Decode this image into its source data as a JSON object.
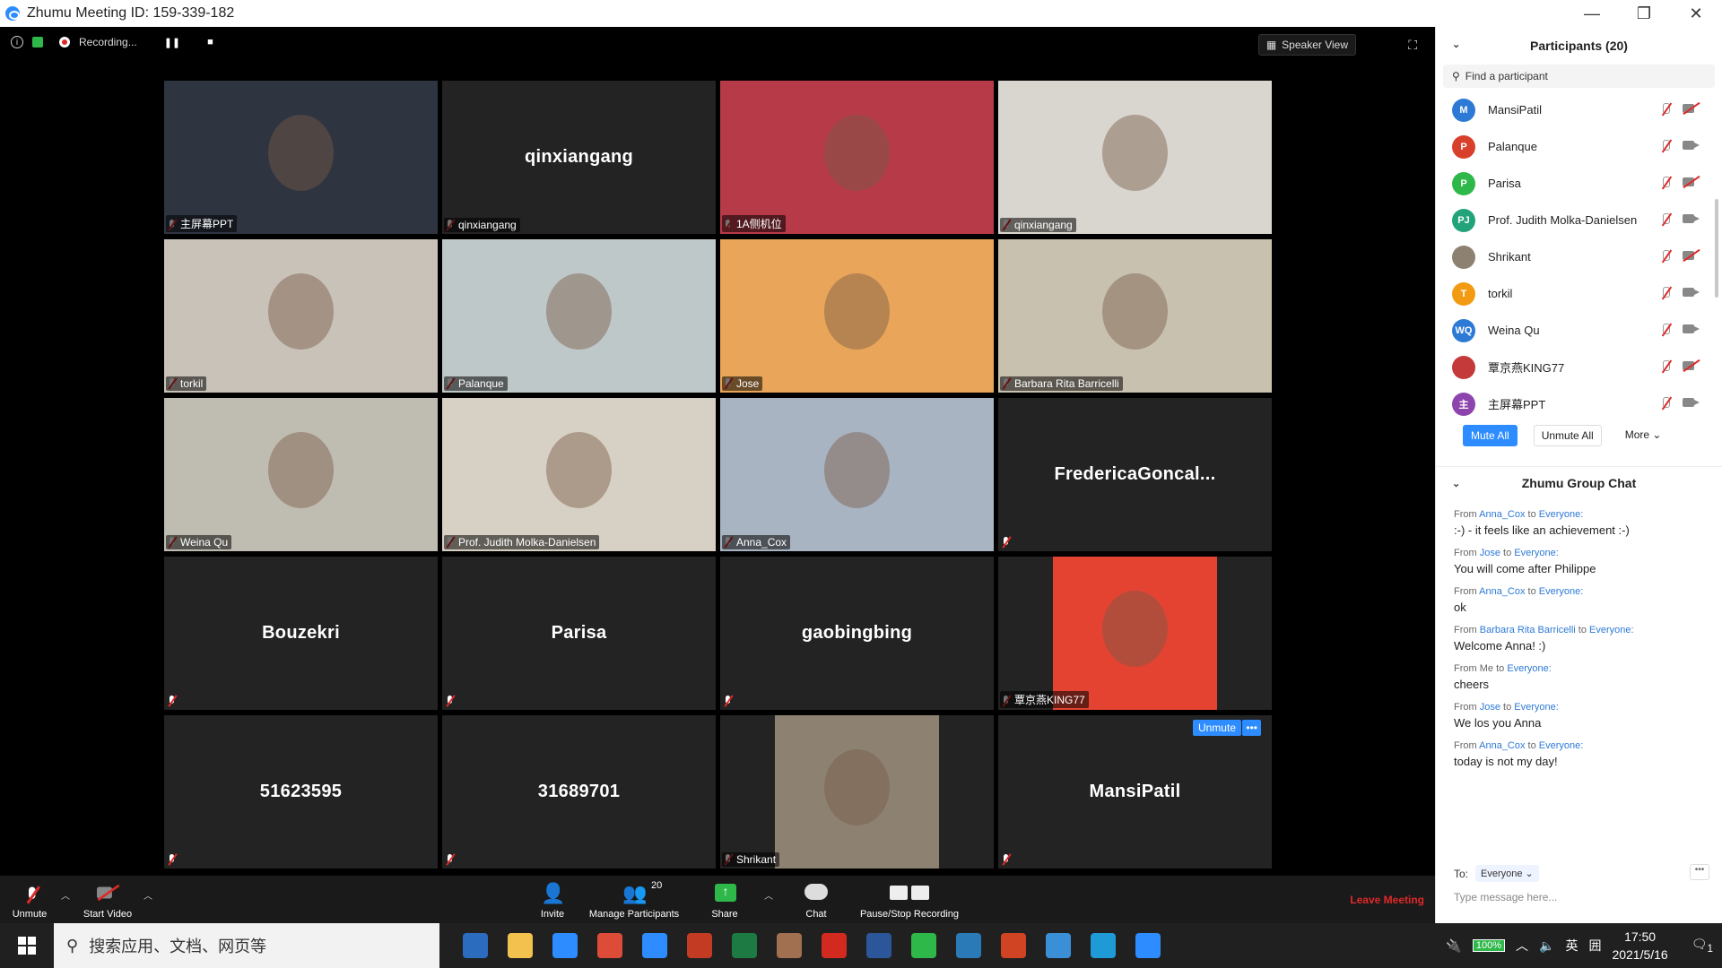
{
  "window": {
    "title": "Zhumu Meeting ID: 159-339-182",
    "min": "—",
    "restore": "❐",
    "close": "✕"
  },
  "topbar": {
    "recording": "Recording...",
    "pause": "❚❚",
    "stop": "■",
    "speaker_view": "Speaker View"
  },
  "tiles": [
    {
      "name": "主屏幕PPT",
      "type": "video",
      "bg": "#2e3440"
    },
    {
      "name": "qinxiangang",
      "type": "name",
      "big": "qinxiangang"
    },
    {
      "name": "1A侧机位",
      "type": "video",
      "bg": "#b73a48"
    },
    {
      "name": "qinxiangang",
      "type": "video",
      "bg": "#d9d6cf"
    },
    {
      "name": "torkil",
      "type": "video",
      "bg": "#c9c2b8"
    },
    {
      "name": "Palanque",
      "type": "video",
      "bg": "#bfc8c8",
      "active": true
    },
    {
      "name": "Jose",
      "type": "video",
      "bg": "#e9a65a"
    },
    {
      "name": "Barbara Rita Barricelli",
      "type": "video",
      "bg": "#c9c1b0"
    },
    {
      "name": "Weina Qu",
      "type": "video",
      "bg": "#bfbcb1"
    },
    {
      "name": "Prof. Judith Molka-Danielsen",
      "type": "video",
      "bg": "#d7d0c4"
    },
    {
      "name": "Anna_Cox",
      "type": "video",
      "bg": "#a9b4c3"
    },
    {
      "name": "",
      "type": "name",
      "big": "FredericaGoncal..."
    },
    {
      "name": "",
      "type": "name",
      "big": "Bouzekri"
    },
    {
      "name": "",
      "type": "name",
      "big": "Parisa"
    },
    {
      "name": "",
      "type": "name",
      "big": "gaobingbing"
    },
    {
      "name": "覃京燕KING77",
      "type": "photo",
      "bg": "#e44332"
    },
    {
      "name": "",
      "type": "name",
      "big": "51623595"
    },
    {
      "name": "",
      "type": "name",
      "big": "31689701"
    },
    {
      "name": "Shrikant",
      "type": "photo",
      "bg": "#8d8272"
    },
    {
      "name": "",
      "type": "name",
      "big": "MansiPatil",
      "overlay_unmute": "Unmute",
      "overlay_more": "•••"
    }
  ],
  "toolbar": {
    "unmute": "Unmute",
    "start_video": "Start Video",
    "invite": "Invite",
    "manage": "Manage Participants",
    "participant_count": "20",
    "share": "Share",
    "chat": "Chat",
    "record": "Pause/Stop Recording",
    "leave": "Leave Meeting"
  },
  "participants": {
    "title": "Participants (20)",
    "search_placeholder": "Find a participant",
    "list": [
      {
        "name": "MansiPatil",
        "initials": "M",
        "color": "#2d7ad6",
        "video_off": true
      },
      {
        "name": "Palanque",
        "initials": "P",
        "color": "#d9402b",
        "video_off": false
      },
      {
        "name": "Parisa",
        "initials": "P",
        "color": "#2fb84a",
        "video_off": true
      },
      {
        "name": "Prof. Judith Molka-Danielsen",
        "initials": "PJ",
        "color": "#23a37a",
        "video_off": false
      },
      {
        "name": "Shrikant",
        "initials": "",
        "color": "#8d8272",
        "video_off": true
      },
      {
        "name": "torkil",
        "initials": "T",
        "color": "#f29a12",
        "video_off": false
      },
      {
        "name": "Weina Qu",
        "initials": "WQ",
        "color": "#2d7ad6",
        "video_off": false
      },
      {
        "name": "覃京燕KING77",
        "initials": "",
        "color": "#c43a3a",
        "video_off": true
      },
      {
        "name": "主屏幕PPT",
        "initials": "主",
        "color": "#8e44ad",
        "video_off": false
      }
    ],
    "mute_all": "Mute All",
    "unmute_all": "Unmute All",
    "more": "More ⌄"
  },
  "chat": {
    "title": "Zhumu Group Chat",
    "messages": [
      {
        "from": "Anna_Cox",
        "to": "Everyone:",
        "text": ":-) - it feels like an achievement :-)"
      },
      {
        "from": "Jose",
        "to": "Everyone:",
        "text": "You will come after Philippe"
      },
      {
        "from": "Anna_Cox",
        "to": "Everyone:",
        "text": "ok"
      },
      {
        "from": "Barbara Rita Barricelli",
        "to": "Everyone:",
        "text": "Welcome Anna! :)"
      },
      {
        "from": "Me",
        "to": "Everyone:",
        "text": "cheers"
      },
      {
        "from": "Jose",
        "to": "Everyone:",
        "text": "We los you Anna"
      },
      {
        "from": "Anna_Cox",
        "to": "Everyone:",
        "text": "today is not my day!"
      }
    ],
    "to_label": "To:",
    "to_value": "Everyone ⌄",
    "placeholder": "Type message here...",
    "more": "•••"
  },
  "taskbar": {
    "search": "搜索应用、文档、网页等",
    "time": "17:50",
    "date": "2021/5/16",
    "battery": "100%",
    "ime": "英",
    "ime2": "囲",
    "notif": "1",
    "apps": [
      "#2b6cbf",
      "#f2c14e",
      "#2d8cff",
      "#dd4b39",
      "#2d8cff",
      "#c23b22",
      "#1d7a42",
      "#a07050",
      "#d22a1f",
      "#2b579a",
      "#2fb84a",
      "#2a7ab8",
      "#d04423",
      "#3b8fd6",
      "#1e9ad6",
      "#2d8cff"
    ]
  }
}
